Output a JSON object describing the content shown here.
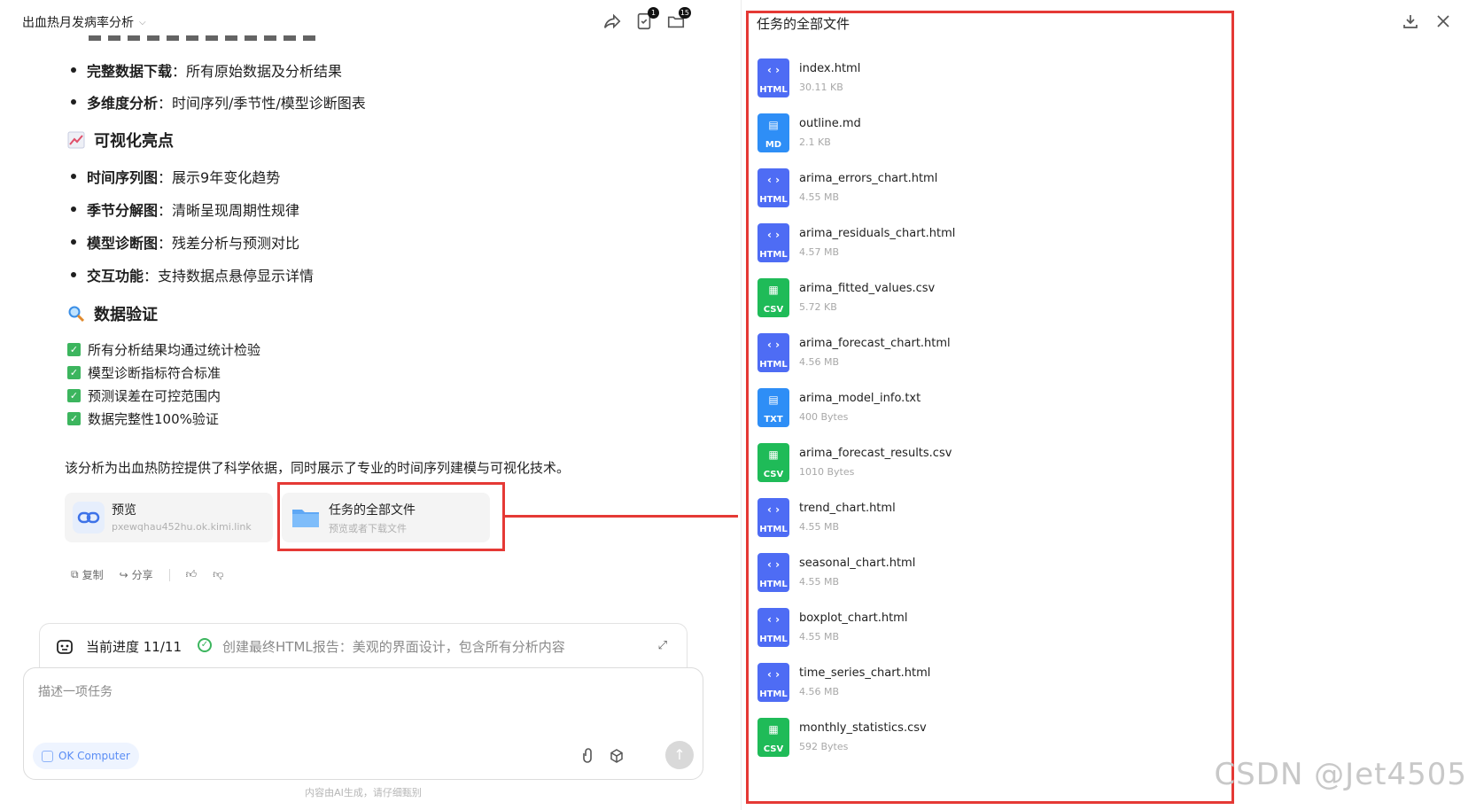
{
  "header": {
    "title": "出血热月发病率分析",
    "task_badge": "1",
    "files_badge": "15"
  },
  "chat": {
    "bullets_top": [
      {
        "bold": "完整数据下载",
        "text": "：所有原始数据及分析结果"
      },
      {
        "bold": "多维度分析",
        "text": "：时间序列/季节性/模型诊断图表"
      }
    ],
    "section_viz": "可视化亮点",
    "bullets_viz": [
      {
        "bold": "时间序列图",
        "text": "：展示9年变化趋势"
      },
      {
        "bold": "季节分解图",
        "text": "：清晰呈现周期性规律"
      },
      {
        "bold": "模型诊断图",
        "text": "：残差分析与预测对比"
      },
      {
        "bold": "交互功能",
        "text": "：支持数据点悬停显示详情"
      }
    ],
    "section_verify": "数据验证",
    "checks": [
      "所有分析结果均通过统计检验",
      "模型诊断指标符合标准",
      "预测误差在可控范围内",
      "数据完整性100%验证"
    ],
    "summary": "该分析为出血热防控提供了科学依据，同时展示了专业的时间序列建模与可视化技术。",
    "cards": [
      {
        "title": "预览",
        "sub": "pxewqhau452hu.ok.kimi.link"
      },
      {
        "title": "任务的全部文件",
        "sub": "预览或者下载文件"
      }
    ],
    "actions": {
      "copy": "复制",
      "share": "分享"
    }
  },
  "progress": {
    "label": "当前进度 11/11",
    "status": "创建最终HTML报告：美观的界面设计，包含所有分析内容"
  },
  "composer": {
    "placeholder": "描述一项任务",
    "chip": "OK Computer"
  },
  "disclaimer": "内容由AI生成，请仔细甄别",
  "files_panel": {
    "title": "任务的全部文件",
    "files": [
      {
        "name": "index.html",
        "size": "30.11 KB",
        "type": "HTML"
      },
      {
        "name": "outline.md",
        "size": "2.1 KB",
        "type": "MD"
      },
      {
        "name": "arima_errors_chart.html",
        "size": "4.55 MB",
        "type": "HTML"
      },
      {
        "name": "arima_residuals_chart.html",
        "size": "4.57 MB",
        "type": "HTML"
      },
      {
        "name": "arima_fitted_values.csv",
        "size": "5.72 KB",
        "type": "CSV"
      },
      {
        "name": "arima_forecast_chart.html",
        "size": "4.56 MB",
        "type": "HTML"
      },
      {
        "name": "arima_model_info.txt",
        "size": "400 Bytes",
        "type": "TXT"
      },
      {
        "name": "arima_forecast_results.csv",
        "size": "1010 Bytes",
        "type": "CSV"
      },
      {
        "name": "trend_chart.html",
        "size": "4.55 MB",
        "type": "HTML"
      },
      {
        "name": "seasonal_chart.html",
        "size": "4.55 MB",
        "type": "HTML"
      },
      {
        "name": "boxplot_chart.html",
        "size": "4.55 MB",
        "type": "HTML"
      },
      {
        "name": "time_series_chart.html",
        "size": "4.56 MB",
        "type": "HTML"
      },
      {
        "name": "monthly_statistics.csv",
        "size": "592 Bytes",
        "type": "CSV"
      }
    ]
  },
  "watermark": "CSDN @Jet4505",
  "colors": {
    "highlight": "#e53935",
    "html_icon": "#4e6cf4",
    "md_icon": "#2e8ef6",
    "csv_icon": "#1fbb58",
    "check": "#3cb55e"
  }
}
